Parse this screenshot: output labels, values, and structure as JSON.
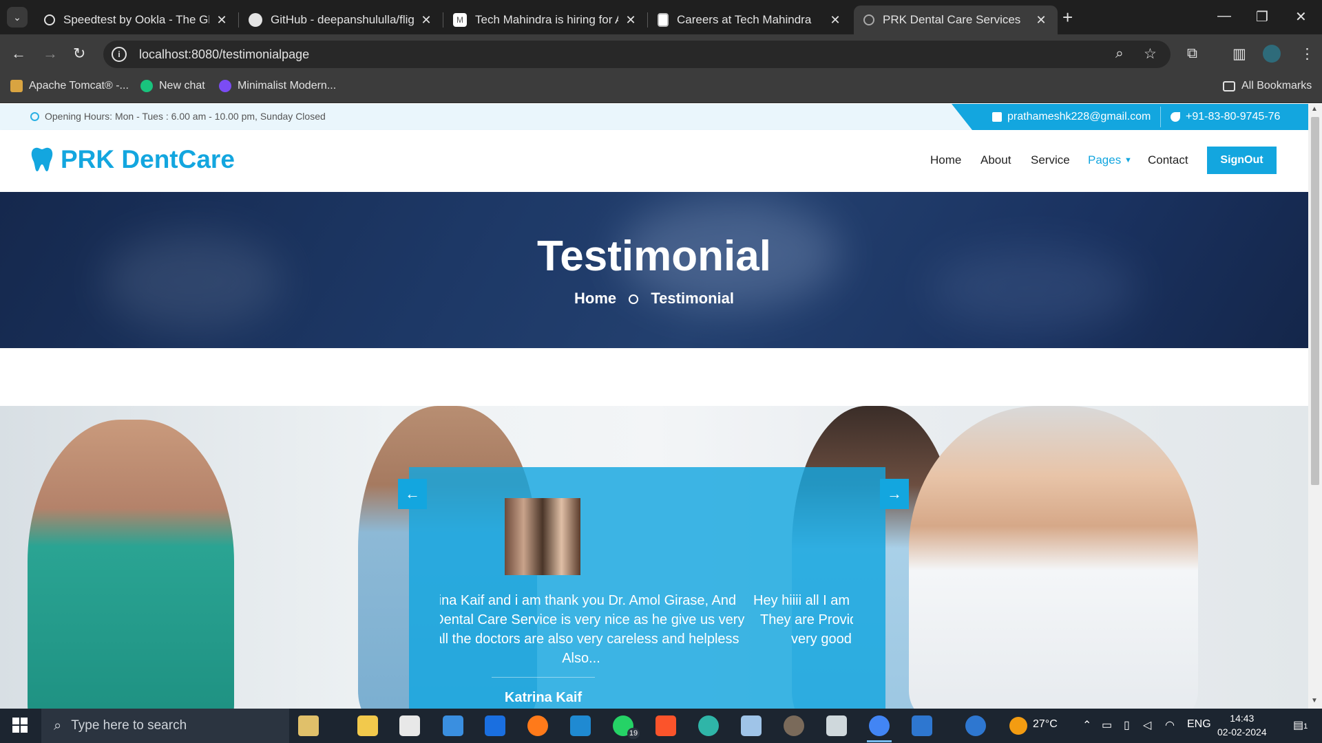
{
  "browser": {
    "tabs": [
      {
        "title": "Speedtest by Ookla - The Global Broadband Speed Test",
        "icon": "speedtest-icon"
      },
      {
        "title": "GitHub - deepanshululla/flight-booking",
        "icon": "github-icon"
      },
      {
        "title": "Tech Mahindra is hiring for Associate",
        "icon": "gmail-icon"
      },
      {
        "title": "Careers at Tech Mahindra",
        "icon": "doc-icon"
      },
      {
        "title": "PRK Dental Care Services",
        "icon": "globe-icon",
        "active": true
      }
    ],
    "url": "localhost:8080/testimonialpage",
    "bookmarks": [
      {
        "label": "Apache Tomcat® -...",
        "icon": "tomcat-icon"
      },
      {
        "label": "New chat",
        "icon": "chatgpt-icon"
      },
      {
        "label": "Minimalist Modern...",
        "icon": "canva-icon"
      }
    ],
    "all_bookmarks": "All Bookmarks"
  },
  "site": {
    "topbar": {
      "hours": "Opening Hours: Mon - Tues : 6.00 am - 10.00 pm, Sunday Closed",
      "email": "prathameshk228@gmail.com",
      "phone": "+91-83-80-9745-76"
    },
    "brand": "PRK DentCare",
    "menu": [
      {
        "label": "Home"
      },
      {
        "label": "About"
      },
      {
        "label": "Service"
      },
      {
        "label": "Pages",
        "active": true
      },
      {
        "label": "Contact"
      }
    ],
    "signout": "SignOut",
    "hero": {
      "title": "Testimonial",
      "breadcrumb_home": "Home",
      "breadcrumb_current": "Testimonial"
    },
    "testimonial": {
      "lines_left": [
        "ıtrina Kaif and i am thank you Dr. Amol Girase, And",
        "al Dental Care Service is very nice as he give us very",
        "d all the doctors are also very careless and helpless",
        "Also..."
      ],
      "lines_right": [
        "Hey hiiii all I am P",
        "They are Provide",
        "very good s"
      ],
      "name": "Katrina Kaif",
      "prev_arrow": "←",
      "next_arrow": "→"
    }
  },
  "taskbar": {
    "search_placeholder": "Type here to search",
    "whatsapp_badge": "19",
    "weather": "27°C",
    "language": "ENG",
    "time": "14:43",
    "date": "02-02-2024",
    "notifications": "1"
  },
  "colors": {
    "brand": "#13a6df",
    "hero_bg": "#1d3866",
    "chrome_dark": "#1f1f1f"
  }
}
